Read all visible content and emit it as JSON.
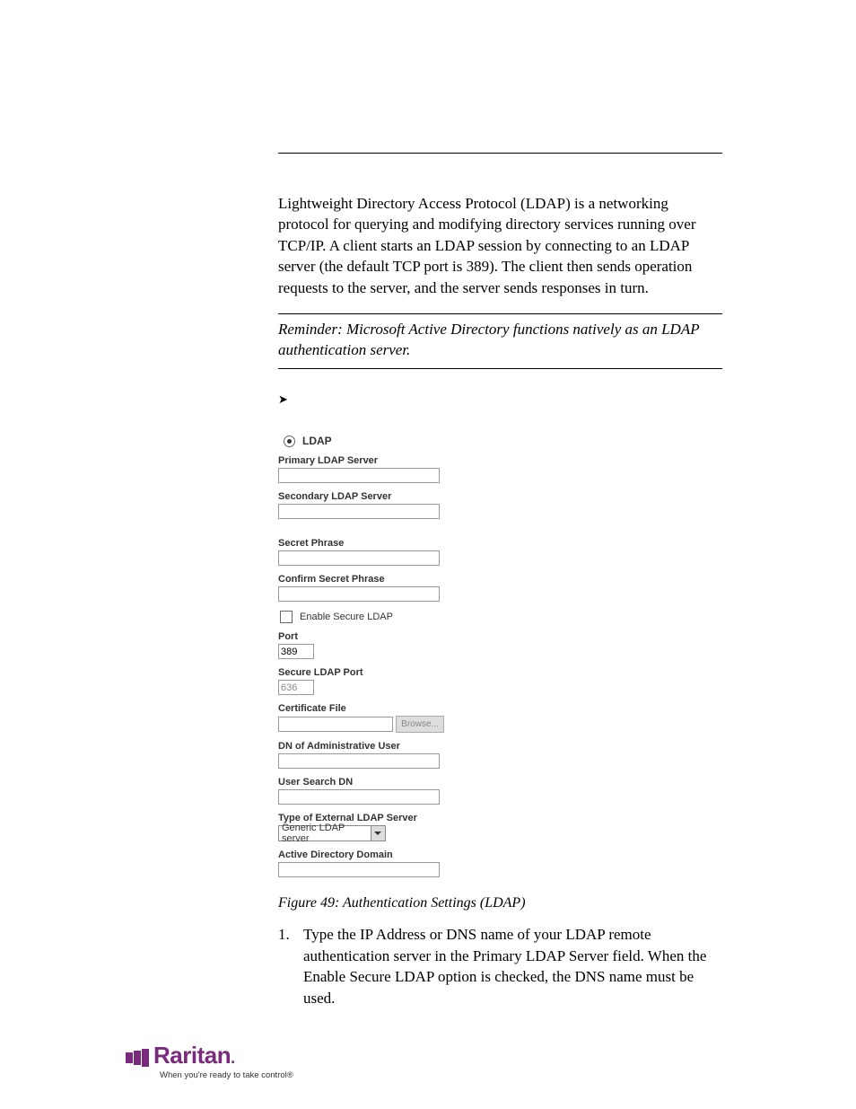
{
  "intro": "Lightweight Directory Access Protocol (LDAP) is a networking protocol for querying and modifying directory services running over TCP/IP. A client starts an LDAP session by connecting to an LDAP server (the default TCP port is 389). The client then sends operation requests to the server, and the server sends responses in turn.",
  "reminder": "Reminder: Microsoft Active Directory functions natively as an LDAP authentication server.",
  "arrow_glyph": "➤",
  "form": {
    "radio_ldap": "LDAP",
    "labels": {
      "primary": "Primary LDAP Server",
      "secondary": "Secondary LDAP Server",
      "secret": "Secret Phrase",
      "confirm_secret": "Confirm Secret Phrase",
      "enable_secure": "Enable Secure LDAP",
      "port": "Port",
      "secure_port": "Secure LDAP Port",
      "cert_file": "Certificate File",
      "browse": "Browse...",
      "dn_admin": "DN of Administrative User",
      "user_search_dn": "User Search DN",
      "type_ext": "Type of External LDAP Server",
      "ad_domain": "Active Directory Domain"
    },
    "values": {
      "port": "389",
      "secure_port": "636",
      "type_ext_selected": "Generic LDAP server"
    }
  },
  "caption": "Figure 49: Authentication Settings (LDAP)",
  "step1": {
    "num": "1.",
    "text": "Type the IP Address or DNS name of your LDAP remote authentication server in the Primary LDAP Server field. When the Enable Secure LDAP option is checked, the DNS name must be used."
  },
  "footer": {
    "brand": "Raritan",
    "dot": ".",
    "tagline": "When you're ready to take control®"
  }
}
